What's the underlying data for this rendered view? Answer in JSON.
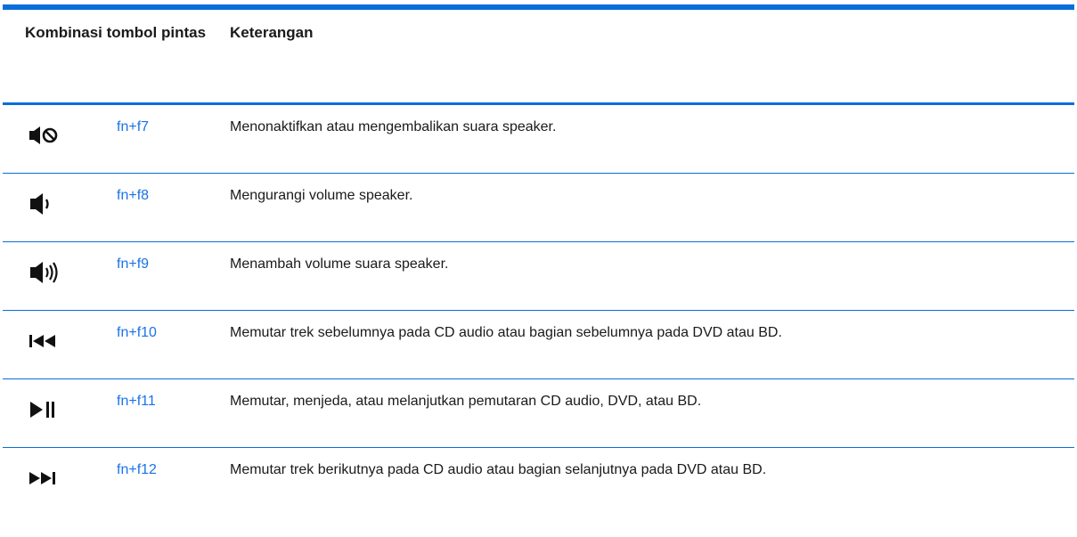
{
  "table": {
    "headers": {
      "shortcut": "Kombinasi tombol pintas",
      "description": "Keterangan"
    },
    "rows": [
      {
        "icon": "mute-icon",
        "key": "fn+f7",
        "description": "Menonaktifkan atau mengembalikan suara speaker."
      },
      {
        "icon": "volume-down-icon",
        "key": "fn+f8",
        "description": "Mengurangi volume speaker."
      },
      {
        "icon": "volume-up-icon",
        "key": "fn+f9",
        "description": "Menambah volume suara speaker."
      },
      {
        "icon": "previous-track-icon",
        "key": "fn+f10",
        "description": "Memutar trek sebelumnya pada CD audio atau bagian sebelumnya pada DVD atau BD."
      },
      {
        "icon": "play-pause-icon",
        "key": "fn+f11",
        "description": "Memutar, menjeda, atau melanjutkan pemutaran CD audio, DVD, atau BD."
      },
      {
        "icon": "next-track-icon",
        "key": "fn+f12",
        "description": "Memutar trek berikutnya pada CD audio atau bagian selanjutnya pada DVD atau BD."
      }
    ]
  },
  "colors": {
    "rule": "#0a6ed8",
    "link": "#1a73e8",
    "text": "#1a1a1a"
  }
}
